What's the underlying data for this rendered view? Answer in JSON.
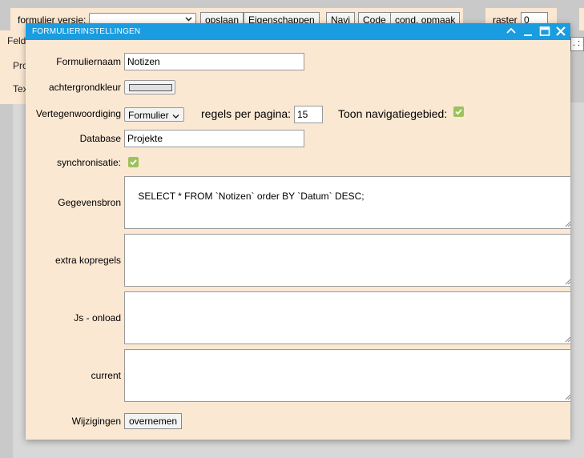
{
  "background": {
    "toolbar": {
      "version_label": "formulier versie:",
      "version_value": "",
      "buttons": [
        "opslaan",
        "Eigenschappen",
        "Navi",
        "Code",
        "cond. opmaak"
      ],
      "raster_label": "raster",
      "raster_value": "0"
    },
    "side_labels": [
      "Feld",
      "Pro",
      "Tex"
    ],
    "right_field": ". :"
  },
  "dialog": {
    "title": "FORMULIERINSTELLINGEN",
    "fields": {
      "form_name_label": "Formuliernaam",
      "form_name_value": "Notizen",
      "bgcolor_label": "achtergrondkleur",
      "representation_label": "Vertegenwoordiging",
      "representation_value": "Formulier",
      "rows_per_page_label": "regels per pagina:",
      "rows_per_page_value": "15",
      "show_nav_label": "Toon navigatiegebied:",
      "show_nav_checked": true,
      "database_label": "Database",
      "database_value": "Projekte",
      "sync_label": "synchronisatie:",
      "sync_checked": true,
      "datasource_label": "Gegevensbron",
      "datasource_value": "SELECT * FROM `Notizen` order BY `Datum` DESC;",
      "extra_headers_label": "extra kopregels",
      "extra_headers_value": "",
      "js_onload_label": "Js - onload",
      "js_onload_value": "",
      "current_label": "current",
      "current_value": "",
      "changes_label": "Wijzigingen",
      "apply_button": "overnemen"
    }
  },
  "colors": {
    "titlebar": "#1a9ce0",
    "dialog_bg": "#fbe8d3",
    "check_green": "#9cc25a"
  }
}
